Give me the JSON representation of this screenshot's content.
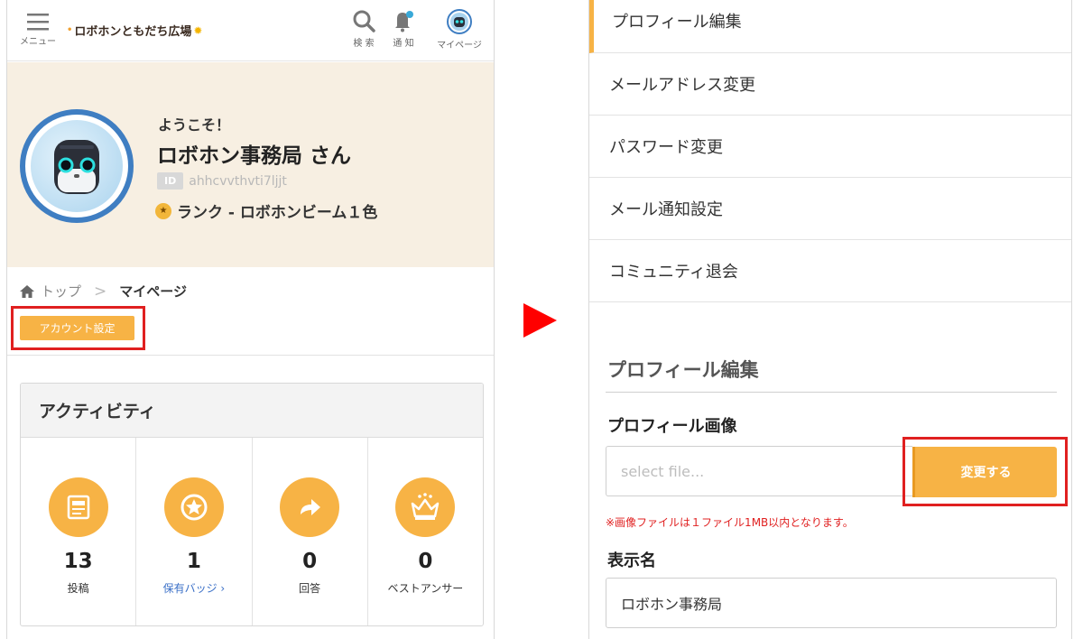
{
  "left": {
    "header": {
      "menu_label": "メニュー",
      "logo_text": "ロボホンともだち広場",
      "search_label": "検 索",
      "notif_label": "通 知",
      "mypage_label": "マイページ"
    },
    "profile": {
      "welcome": "ようこそ！",
      "username": "ロボホン事務局 さん",
      "id_tag": "ID",
      "id_value": "ahhcvvthvti7ljjt",
      "rank": "ランク - ロボホンビーム１色"
    },
    "breadcrumb": {
      "top": "トップ",
      "separator": ">",
      "current": "マイページ"
    },
    "account_button": "アカウント設定",
    "activity": {
      "title": "アクティビティ",
      "stats": [
        {
          "icon": "document-icon",
          "value": "13",
          "label": "投稿"
        },
        {
          "icon": "star-badge-icon",
          "value": "1",
          "label": "保有バッジ ›"
        },
        {
          "icon": "reply-arrow-icon",
          "value": "0",
          "label": "回答"
        },
        {
          "icon": "crown-icon",
          "value": "0",
          "label": "ベストアンサー"
        }
      ]
    }
  },
  "right": {
    "menu": [
      "プロフィール編集",
      "メールアドレス変更",
      "パスワード変更",
      "メール通知設定",
      "コミュニティ退会"
    ],
    "section_title": "プロフィール編集",
    "image_label": "プロフィール画像",
    "file_placeholder": "select file...",
    "change_button": "変更する",
    "note": "※画像ファイルは１ファイル1MB以内となります。",
    "display_label": "表示名",
    "display_value": "ロボホン事務局"
  },
  "colors": {
    "accent": "#f7b345",
    "highlight": "#e02020",
    "arrow": "#ff0000",
    "profile_bg": "#f7efe2",
    "avatar_ring": "#3f7ec2",
    "link": "#3a6fc7"
  }
}
